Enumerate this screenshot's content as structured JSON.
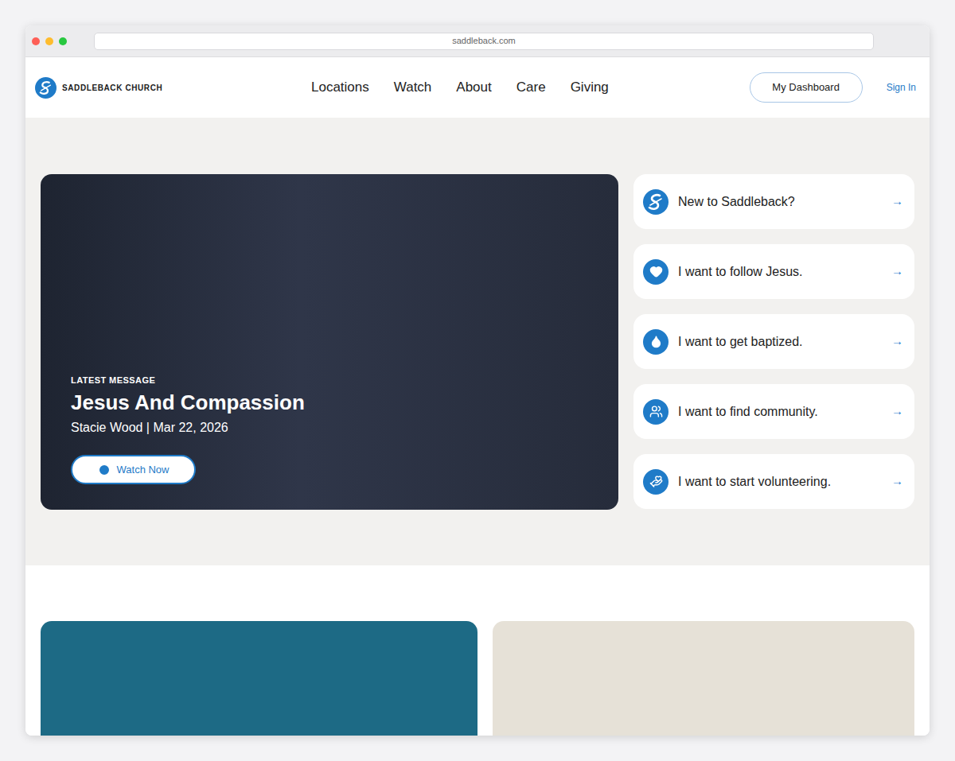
{
  "window": {
    "url": "saddleback.com"
  },
  "header": {
    "logo": "SADDLEBACK CHURCH",
    "nav": [
      {
        "label": "Locations"
      },
      {
        "label": "Watch"
      },
      {
        "label": "About"
      },
      {
        "label": "Care"
      },
      {
        "label": "Giving"
      }
    ],
    "dashboard_button": "My Dashboard",
    "sign_in": "Sign In"
  },
  "hero": {
    "eyebrow": "LATEST MESSAGE",
    "title": "Jesus And Compassion",
    "subtitle": "Stacie Wood | Mar 22, 2026",
    "button": "Watch Now"
  },
  "quick_links": [
    {
      "label": "New to Saddleback?",
      "kind": "logo"
    },
    {
      "label": "I want to follow Jesus.",
      "kind": "heart"
    },
    {
      "label": "I want to get baptized.",
      "kind": "drop"
    },
    {
      "label": "I want to find community.",
      "kind": "people"
    },
    {
      "label": "I want to start volunteering.",
      "kind": "hand"
    }
  ],
  "arrow": "→",
  "cards": [
    {
      "color": "#1d6a85"
    },
    {
      "color": "#e6e1d7"
    }
  ]
}
